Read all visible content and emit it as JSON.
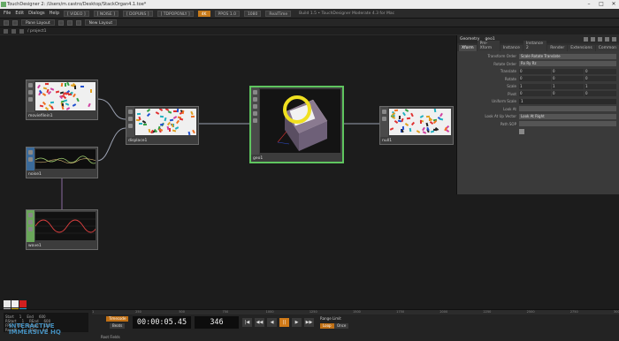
{
  "window": {
    "title": "TouchDesigner 2: /Users/m.castro/Desktop/StackOrgan4.1.toe*",
    "controls": [
      "–",
      "□",
      "✕"
    ]
  },
  "menubar": {
    "items": [
      "File",
      "Edit",
      "Dialogs",
      "Help"
    ],
    "tags": [
      "[ VIDEO ]",
      "[ NOISE ]",
      "[ DOPUNS ]",
      "[ TDPOPONLY ]",
      "4K",
      "PPOS 1.0",
      "1080",
      "RealTime"
    ],
    "status": "Build 1.5 • TouchDesigner Moderate 4.3 for Mac"
  },
  "toolbar": {
    "pane_layout": "Pane Layout",
    "new_layout": "New Layout"
  },
  "pathbar": {
    "path": "/ project1"
  },
  "nodes": {
    "movie": "moviefilein1",
    "displace": "displace1",
    "noise": "noise1",
    "geo": "geo1",
    "null": "null1",
    "wave": "wave1"
  },
  "params": {
    "header": "Geometry",
    "op_name": "geo1",
    "tabs": [
      "Xform",
      "Pre-Xform",
      "Instance",
      "Instance 2",
      "Render",
      "Extensions",
      "Common"
    ],
    "rows": [
      {
        "label": "Transform Order",
        "value": "Scale Rotate Translate"
      },
      {
        "label": "Rotate Order",
        "value": "Rx Ry Rz"
      },
      {
        "label": "Translate",
        "x": "0",
        "y": "0",
        "z": "0"
      },
      {
        "label": "Rotate",
        "x": "0",
        "y": "0",
        "z": "0"
      },
      {
        "label": "Scale",
        "x": "1",
        "y": "1",
        "z": "1"
      },
      {
        "label": "Pivot",
        "x": "0",
        "y": "0",
        "z": "0"
      },
      {
        "label": "Uniform Scale",
        "value": "1"
      },
      {
        "label": "Look At",
        "value": ""
      },
      {
        "label": "Look At Up Vector",
        "value": "Look At Right"
      },
      {
        "label": "Path SOP",
        "value": ""
      }
    ]
  },
  "palette": {
    "colors": [
      "#e8e8e8",
      "#f0f0f0",
      "#d02020",
      "#c8c8c8",
      "#e0c020",
      "#30a0d0",
      "#20c030",
      "#3050d0",
      "#d040a0",
      "#f08020",
      "#e02020",
      "#20c0c0"
    ]
  },
  "timeline": {
    "root_label": "Root Fields",
    "ruler": [
      "1",
      "250",
      "500",
      "750",
      "1000",
      "1250",
      "1500",
      "1750",
      "2000",
      "2250",
      "2500",
      "2750",
      "3000"
    ],
    "info": [
      [
        "Start",
        "1",
        "End",
        "600"
      ],
      [
        "RStart",
        "1",
        "REnd",
        "600"
      ],
      [
        "FPS",
        "60",
        "Tempo",
        "120"
      ],
      [
        "Resetf",
        "1",
        "TSig",
        "4 4"
      ]
    ],
    "timecode_btn": "Timecode",
    "beats_btn": "Beats",
    "timecode": "00:00:05.45",
    "frame": "346",
    "transport": [
      "|◀",
      "◀◀",
      "◀",
      "||",
      "▶",
      "▶▶"
    ],
    "range_label": "Range Limit",
    "loop_btn": "Loop",
    "once_btn": "Once",
    "watermark_1": "INTERACTIVE",
    "watermark_2": "IMMERSIVE HQ"
  },
  "colors": {
    "selected": "#5fc55f",
    "accent": "#d07a18",
    "wire": "#9aa0b0"
  }
}
